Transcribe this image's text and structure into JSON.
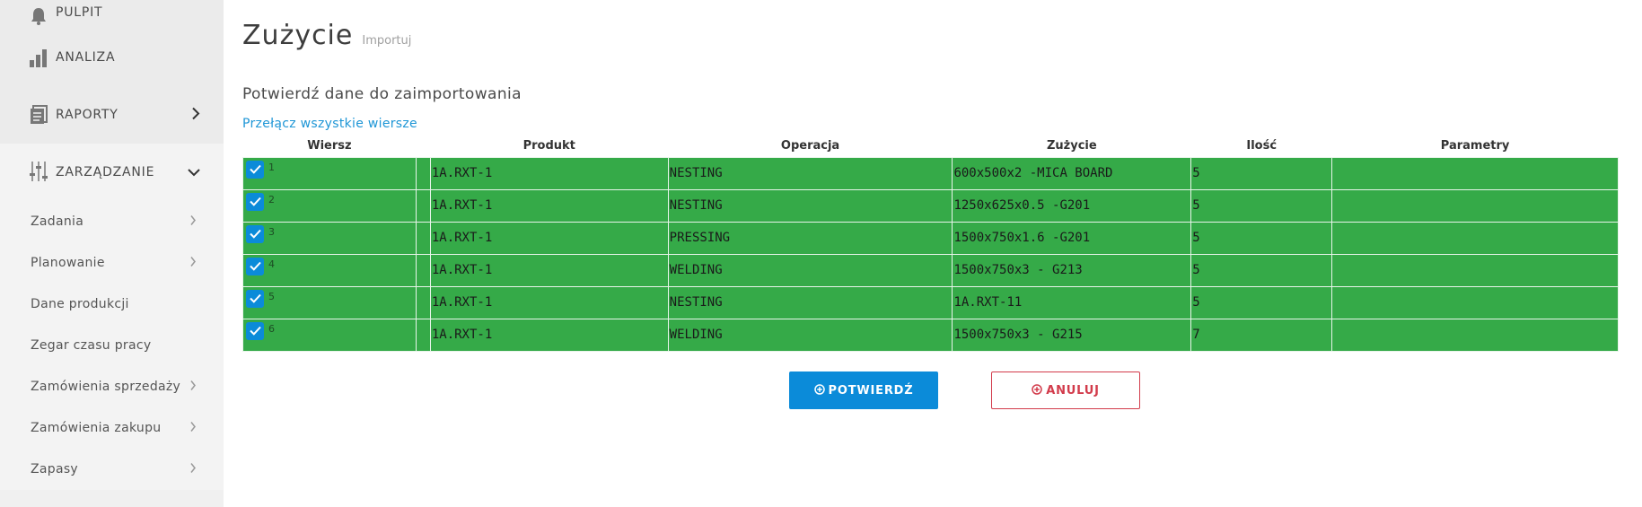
{
  "sidebar": {
    "top_items": [
      {
        "label": "PULPIT",
        "icon": "bell-icon"
      },
      {
        "label": "ANALIZA",
        "icon": "bar-chart-icon"
      },
      {
        "label": "RAPORTY",
        "icon": "document-icon",
        "chevron": "right"
      }
    ],
    "section": {
      "label": "ZARZĄDZANIE",
      "icon": "sliders-icon",
      "chevron": "down"
    },
    "sub_items": [
      {
        "label": "Zadania",
        "has_chevron": true
      },
      {
        "label": "Planowanie",
        "has_chevron": true
      },
      {
        "label": "Dane produkcji",
        "has_chevron": false
      },
      {
        "label": "Zegar czasu pracy",
        "has_chevron": false
      },
      {
        "label": "Zamówienia sprzedaży",
        "has_chevron": true
      },
      {
        "label": "Zamówienia zakupu",
        "has_chevron": true
      },
      {
        "label": "Zapasy",
        "has_chevron": true
      }
    ]
  },
  "header": {
    "title": "Zużycie",
    "subtitle": "Importuj"
  },
  "section_title": "Potwierdź dane do zaimportowania",
  "toggle_all_label": "Przełącz wszystkie wiersze",
  "table": {
    "columns": [
      "Wiersz",
      "Produkt",
      "Operacja",
      "Zużycie",
      "Ilość",
      "Parametry"
    ],
    "rows": [
      {
        "num": "1",
        "checked": true,
        "product": "1A.RXT-1",
        "operation": "NESTING",
        "usage": "600x500x2 -MICA BOARD",
        "qty": "5",
        "params": ""
      },
      {
        "num": "2",
        "checked": true,
        "product": "1A.RXT-1",
        "operation": "NESTING",
        "usage": "1250x625x0.5 -G201",
        "qty": "5",
        "params": ""
      },
      {
        "num": "3",
        "checked": true,
        "product": "1A.RXT-1",
        "operation": "PRESSING",
        "usage": "1500x750x1.6 -G201",
        "qty": "5",
        "params": ""
      },
      {
        "num": "4",
        "checked": true,
        "product": "1A.RXT-1",
        "operation": "WELDING",
        "usage": "1500x750x3 - G213",
        "qty": "5",
        "params": ""
      },
      {
        "num": "5",
        "checked": true,
        "product": "1A.RXT-1",
        "operation": "NESTING",
        "usage": "1A.RXT-11",
        "qty": "5",
        "params": ""
      },
      {
        "num": "6",
        "checked": true,
        "product": "1A.RXT-1",
        "operation": "WELDING",
        "usage": "1500x750x3 - G215",
        "qty": "7",
        "params": ""
      }
    ]
  },
  "buttons": {
    "confirm": "POTWIERDŹ",
    "cancel": "ANULUJ"
  },
  "colors": {
    "row_green": "#35aa48",
    "accent_blue": "#0b8bd9",
    "cancel_red": "#d23b4b",
    "link_blue": "#1e96d6"
  }
}
